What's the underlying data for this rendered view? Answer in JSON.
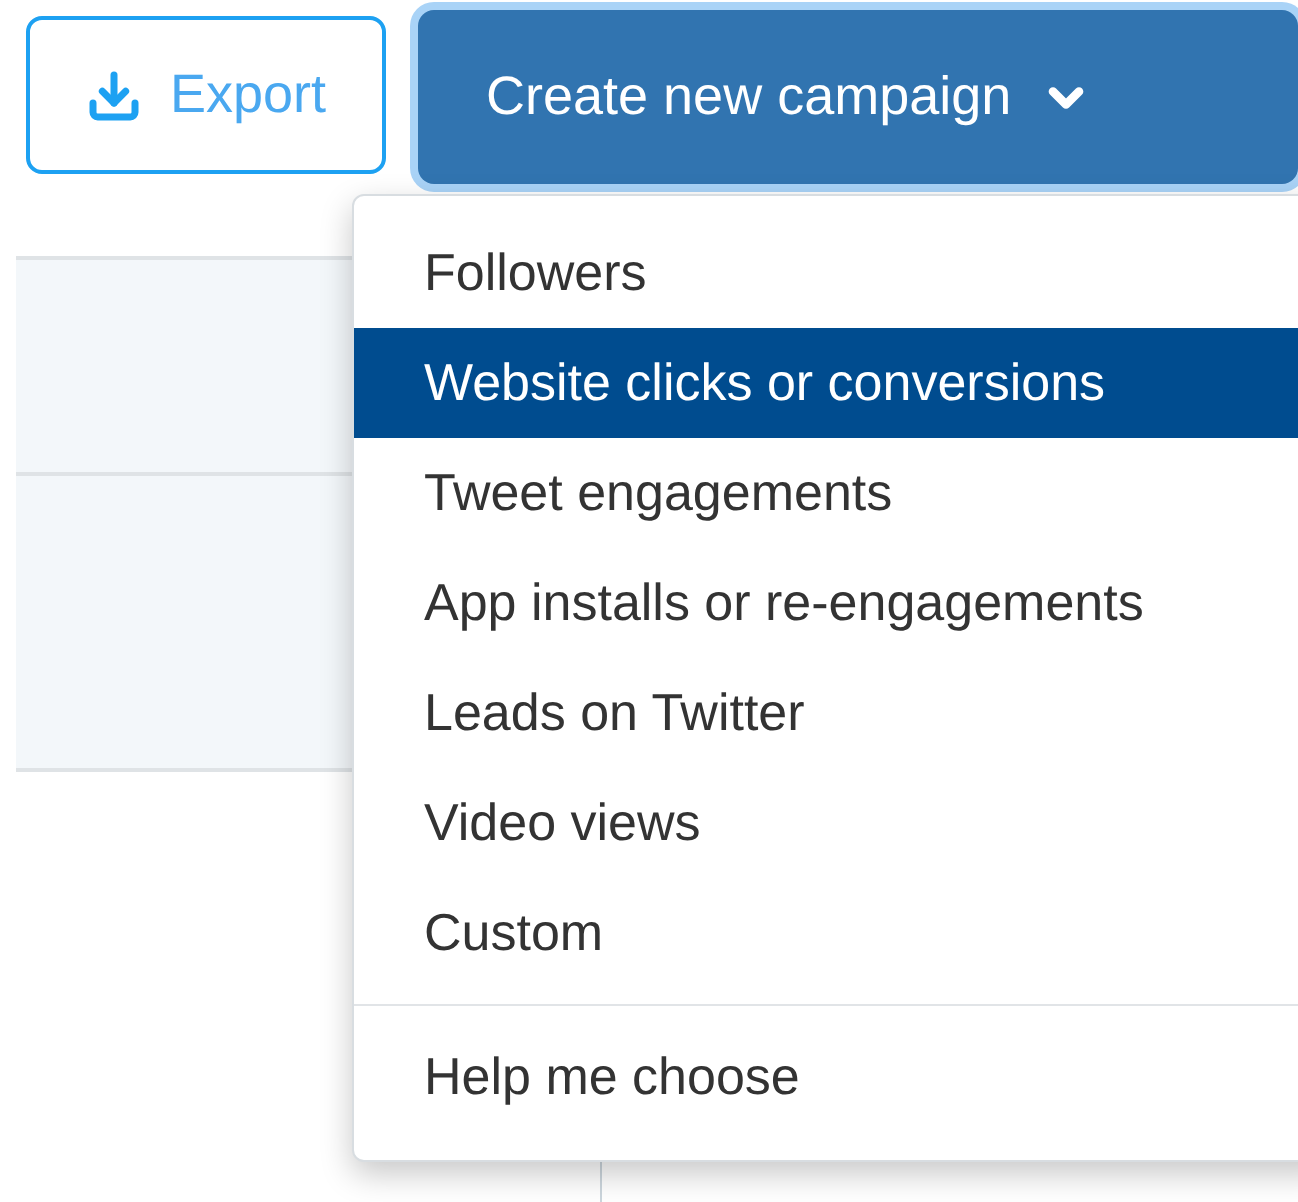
{
  "toolbar": {
    "export_button": "Export",
    "create_button": "Create new campaign"
  },
  "menu": {
    "items": [
      {
        "label": "Followers",
        "selected": false
      },
      {
        "label": "Website clicks or conversions",
        "selected": true
      },
      {
        "label": "Tweet engagements",
        "selected": false
      },
      {
        "label": "App installs or re-engagements",
        "selected": false
      },
      {
        "label": "Leads on Twitter",
        "selected": false
      },
      {
        "label": "Video views",
        "selected": false
      },
      {
        "label": "Custom",
        "selected": false
      }
    ],
    "footer": "Help me choose"
  }
}
